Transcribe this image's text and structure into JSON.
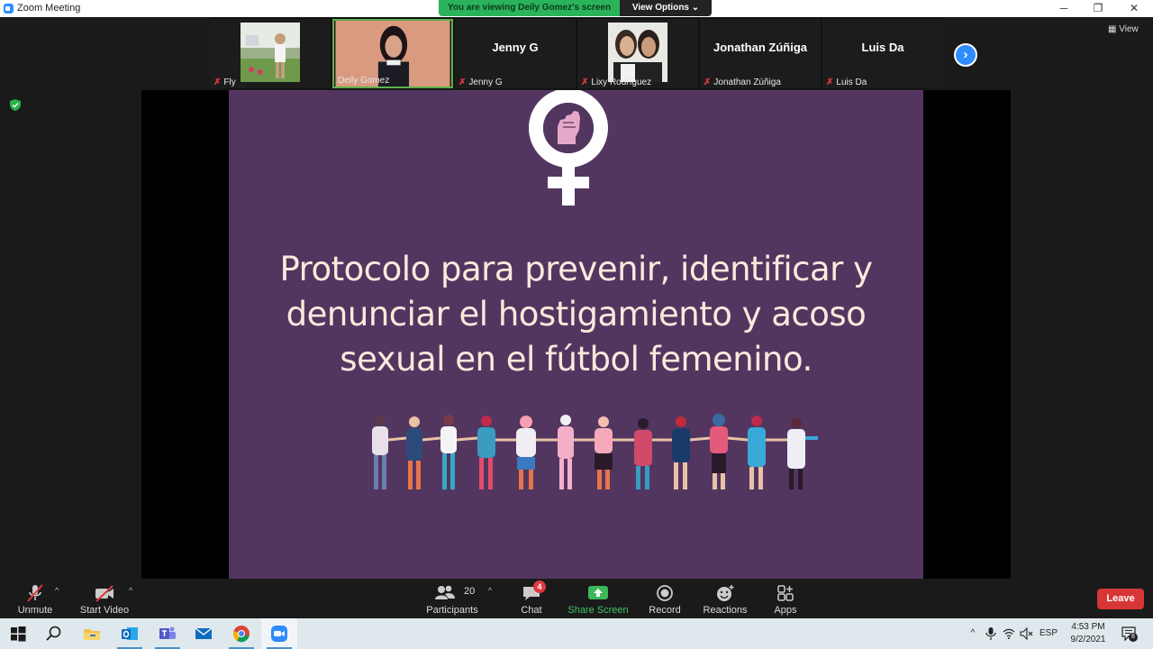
{
  "window": {
    "title": "Zoom Meeting",
    "minimize": "─",
    "restore": "❐",
    "close": "✕"
  },
  "banner": {
    "viewing_text": "You are viewing Deily Gomez's screen",
    "view_options": "View Options ⌄"
  },
  "view_button": "▦ View",
  "participants_strip": [
    {
      "name": "Fly",
      "display": "photo",
      "muted": true
    },
    {
      "name": "Deily Gomez",
      "display": "photo",
      "muted": false,
      "active_speaker": true
    },
    {
      "name": "Jenny G",
      "display": "name",
      "muted": true
    },
    {
      "name": "Lixy Rodríguez",
      "display": "photo",
      "muted": true
    },
    {
      "name": "Jonathan Zúñiga",
      "display": "name",
      "muted": true
    },
    {
      "name": "Luis Da",
      "display": "name",
      "muted": true
    }
  ],
  "next_page": "›",
  "slide": {
    "title_line1": "Protocolo para prevenir, identificar y",
    "title_line2": "denunciar el hostigamiento y acoso",
    "title_line3": "sexual en el fútbol femenino."
  },
  "toolbar": {
    "unmute": "Unmute",
    "start_video": "Start Video",
    "participants": "Participants",
    "participant_count": "20",
    "chat": "Chat",
    "chat_badge": "4",
    "share_screen": "Share Screen",
    "record": "Record",
    "reactions": "Reactions",
    "apps": "Apps",
    "leave": "Leave",
    "caret": "^"
  },
  "taskbar": {
    "apps": [
      "start-icon",
      "search-icon",
      "file-explorer-icon",
      "outlook-icon",
      "teams-icon",
      "mail-icon",
      "chrome-icon",
      "zoom-icon"
    ],
    "tray_chevron": "^",
    "language": "ESP",
    "time": "4:53 PM",
    "date": "9/2/2021",
    "notification_count": "8"
  },
  "colors": {
    "slide_background": "#533660",
    "slide_text": "#fde9dc",
    "zoom_blue": "#2d8cff",
    "leave_red": "#d83636",
    "share_green": "#41c467"
  }
}
